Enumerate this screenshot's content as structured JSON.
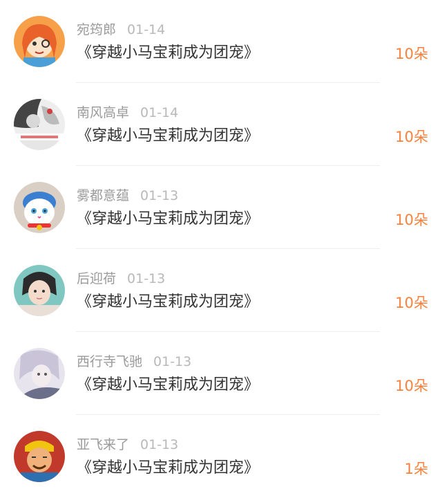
{
  "accent_color": "#f5813d",
  "gifts": [
    {
      "user": "宛筠郎",
      "date": "01-14",
      "book": "《穿越小马宝莉成为团宠》",
      "amount": "10朵",
      "avatar_icon": "cartoon-girl-avatar"
    },
    {
      "user": "南风高卓",
      "date": "01-14",
      "book": "《穿越小马宝莉成为团宠》",
      "amount": "10朵",
      "avatar_icon": "photo-avatar"
    },
    {
      "user": "雾都意蕴",
      "date": "01-13",
      "book": "《穿越小马宝莉成为团宠》",
      "amount": "10朵",
      "avatar_icon": "cat-avatar"
    },
    {
      "user": "后迎荷",
      "date": "01-13",
      "book": "《穿越小马宝莉成为团宠》",
      "amount": "10朵",
      "avatar_icon": "girl-photo-avatar"
    },
    {
      "user": "西行寺飞驰",
      "date": "01-13",
      "book": "《穿越小马宝莉成为团宠》",
      "amount": "10朵",
      "avatar_icon": "anime-avatar"
    },
    {
      "user": "亚飞来了",
      "date": "01-13",
      "book": "《穿越小马宝莉成为团宠》",
      "amount": "1朵",
      "avatar_icon": "cartoon-man-avatar"
    }
  ]
}
